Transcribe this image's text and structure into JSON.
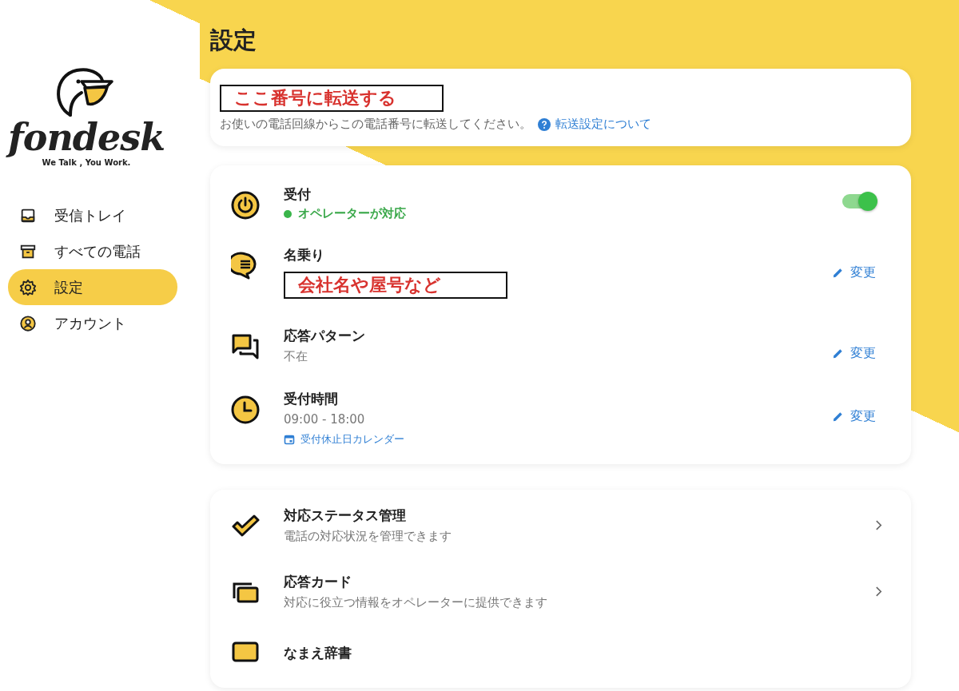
{
  "logo": {
    "name": "fondesk",
    "tagline": "We Talk , You Work."
  },
  "nav": [
    {
      "label": "受信トレイ",
      "selected": false
    },
    {
      "label": "すべての電話",
      "selected": false
    },
    {
      "label": "設定",
      "selected": true
    },
    {
      "label": "アカウント",
      "selected": false
    }
  ],
  "title": "設定",
  "forwarding": {
    "annotation": "ここ番号に転送する",
    "description": "お使いの電話回線からこの電話番号に転送してください。",
    "link": "転送設定について"
  },
  "reception_settings": [
    {
      "kind": "toggle",
      "title": "受付",
      "status": "オペレーターが対応",
      "on": true
    },
    {
      "kind": "edit",
      "title": "名乗り",
      "annotation": "会社名や屋号など",
      "action": "変更"
    },
    {
      "kind": "edit",
      "title": "応答パターン",
      "value": "不在",
      "action": "変更"
    },
    {
      "kind": "edit",
      "title": "受付時間",
      "value": "09:00 - 18:00",
      "link": "受付休止日カレンダー",
      "action": "変更"
    }
  ],
  "feature_settings": [
    {
      "title": "対応ステータス管理",
      "description": "電話の対応状況を管理できます"
    },
    {
      "title": "応答カード",
      "description": "対応に役立つ情報をオペレーターに提供できます"
    },
    {
      "title": "なまえ辞書"
    }
  ]
}
